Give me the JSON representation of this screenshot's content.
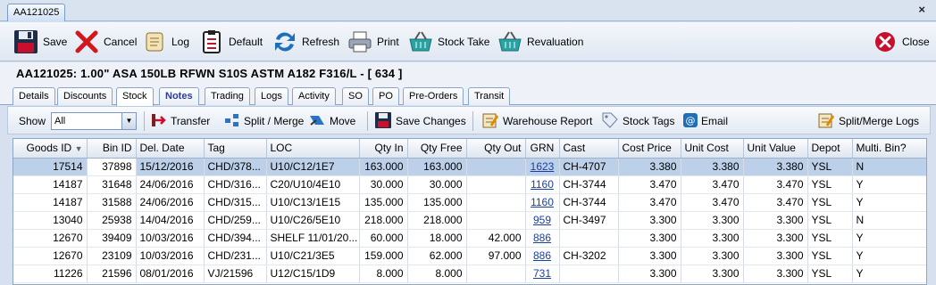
{
  "doc_tab": {
    "label": "AA121025",
    "close": "×"
  },
  "toolbar": {
    "save": "Save",
    "cancel": "Cancel",
    "log": "Log",
    "default": "Default",
    "refresh": "Refresh",
    "print": "Print",
    "stock_take": "Stock Take",
    "revaluation": "Revaluation",
    "close": "Close"
  },
  "title": "AA121025: 1.00\" ASA 150LB RFWN S10S ASTM A182 F316/L - [ 634 ]",
  "subtabs": [
    "Details",
    "Discounts",
    "Stock",
    "Notes",
    "Trading",
    "Logs",
    "Activity",
    "SO",
    "PO",
    "Pre-Orders",
    "Transit"
  ],
  "active_subtab": "Stock",
  "subtoolbar": {
    "show_label": "Show",
    "show_value": "All",
    "transfer": "Transfer",
    "split_merge": "Split / Merge",
    "move": "Move",
    "save_changes": "Save Changes",
    "warehouse_report": "Warehouse Report",
    "stock_tags": "Stock Tags",
    "email": "Email",
    "split_merge_logs": "Split/Merge Logs"
  },
  "grid": {
    "columns": [
      "Goods ID",
      "Bin ID",
      "Del. Date",
      "Tag",
      "LOC",
      "Qty In",
      "Qty Free",
      "Qty Out",
      "GRN",
      "Cast",
      "Cost Price",
      "Unit Cost",
      "Unit Value",
      "Depot",
      "Multi. Bin?"
    ],
    "sort_indicator": "▼",
    "rows": [
      [
        "17514",
        "37898",
        "15/12/2016",
        "CHD/378...",
        "U10/C12/1E7",
        "163.000",
        "163.000",
        "",
        "1623",
        "CH-4707",
        "3.380",
        "3.380",
        "3.380",
        "YSL",
        "N"
      ],
      [
        "14187",
        "31648",
        "24/06/2016",
        "CHD/316...",
        "C20/U10/4E10",
        "30.000",
        "30.000",
        "",
        "1160",
        "CH-3744",
        "3.470",
        "3.470",
        "3.470",
        "YSL",
        "Y"
      ],
      [
        "14187",
        "31588",
        "24/06/2016",
        "CHD/315...",
        "U10/C13/1E15",
        "135.000",
        "135.000",
        "",
        "1160",
        "CH-3744",
        "3.470",
        "3.470",
        "3.470",
        "YSL",
        "Y"
      ],
      [
        "13040",
        "25938",
        "14/04/2016",
        "CHD/259...",
        "U10/C26/5E10",
        "218.000",
        "218.000",
        "",
        "959",
        "CH-3497",
        "3.300",
        "3.300",
        "3.300",
        "YSL",
        "N"
      ],
      [
        "12670",
        "39409",
        "10/03/2016",
        "CHD/394...",
        "SHELF 11/01/20...",
        "60.000",
        "18.000",
        "42.000",
        "886",
        "",
        "3.300",
        "3.300",
        "3.300",
        "YSL",
        "Y"
      ],
      [
        "12670",
        "23109",
        "10/03/2016",
        "CHD/231...",
        "U10/C21/3E5",
        "159.000",
        "62.000",
        "97.000",
        "886",
        "CH-3202",
        "3.300",
        "3.300",
        "3.300",
        "YSL",
        "Y"
      ],
      [
        "11226",
        "21596",
        "08/01/2016",
        "VJ/21596",
        "U12/C15/1D9",
        "8.000",
        "8.000",
        "",
        "731",
        "",
        "3.300",
        "3.300",
        "3.300",
        "YSL",
        "Y"
      ]
    ]
  }
}
